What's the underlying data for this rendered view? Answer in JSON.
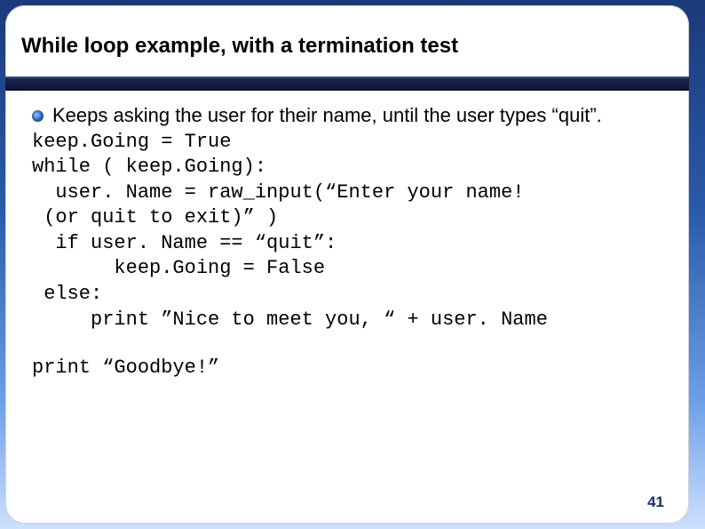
{
  "title": "While loop example, with a termination test",
  "bullet_text": "Keeps asking the user for their name, until the user types “quit”.",
  "code": {
    "l1": "keep.Going = True",
    "l2": "while ( keep.Going):",
    "l3": "  user. Name = raw_input(“Enter your name!",
    "l4": " (or quit to exit)” )",
    "l5": "  if user. Name == “quit”:",
    "l6": "       keep.Going = False",
    "l7": " else:",
    "l8": "     print ”Nice to meet you, “ + user. Name",
    "l9": "print “Goodbye!”"
  },
  "page_number": "41"
}
